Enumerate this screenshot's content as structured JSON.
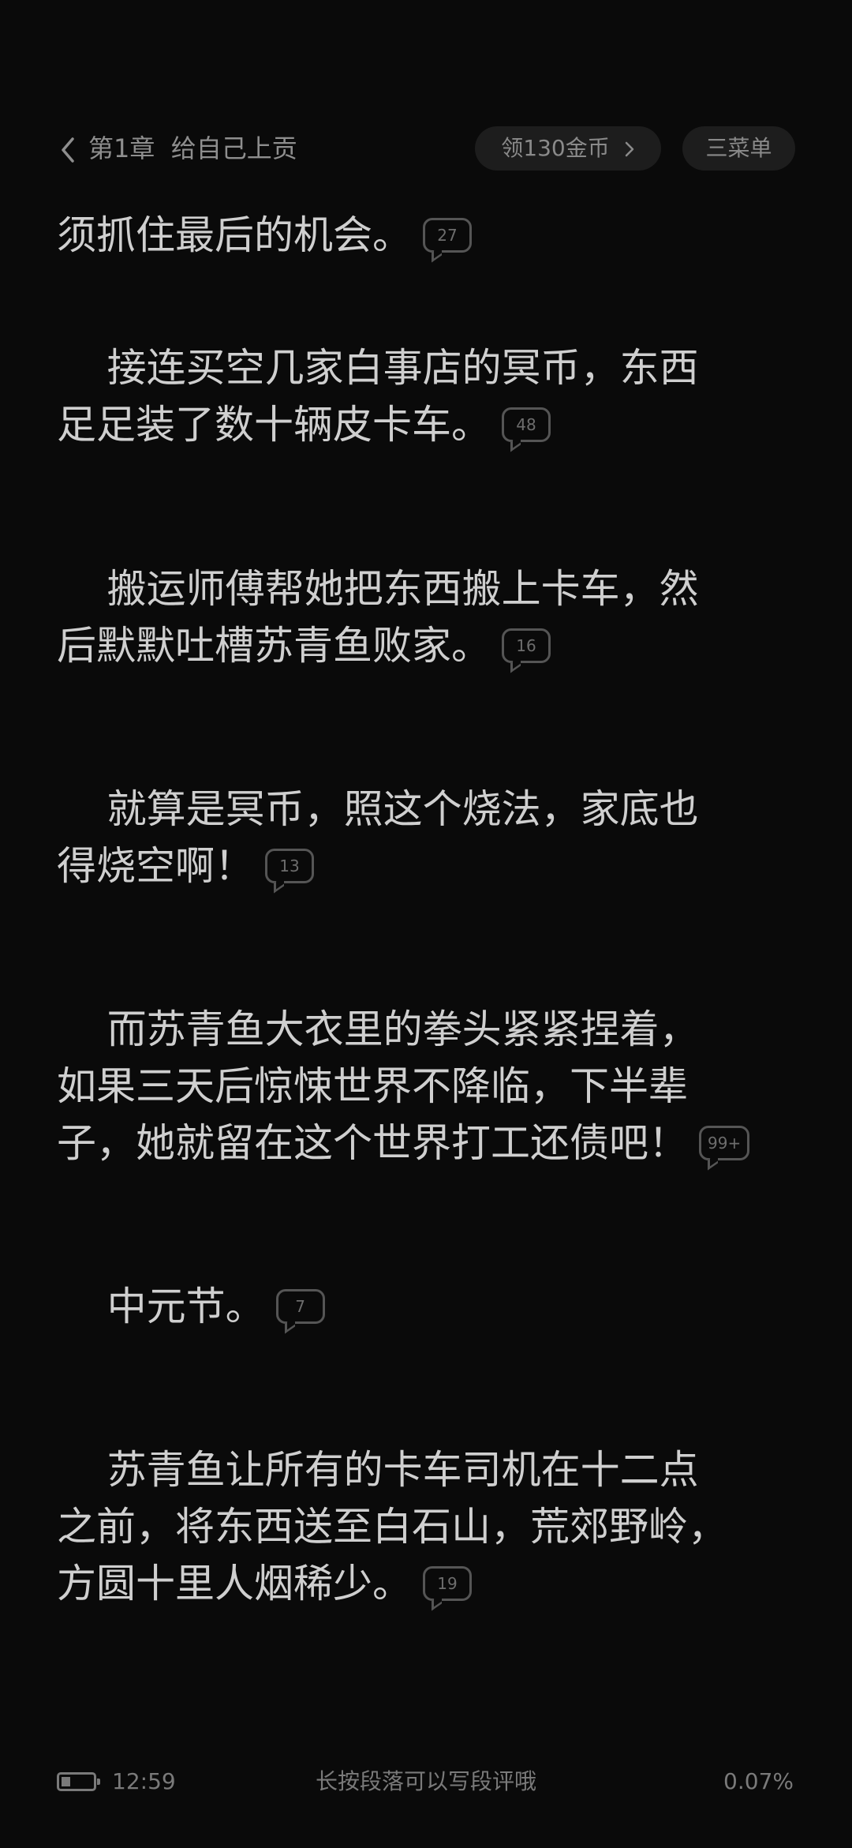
{
  "header": {
    "back_icon": "chevron-left-icon",
    "chapter_title": "第1章  给自己上贡",
    "coins_label": "领130金币",
    "coins_chevron_icon": "chevron-right-icon",
    "menu_label": "三菜单"
  },
  "paragraph_lines": [
    {
      "text": "须抓住最后的机会。",
      "comments": "27"
    },
    {
      "text": "    接连买空几家白事店的冥币，东西",
      "comments": null
    },
    {
      "text": "足足装了数十辆皮卡车。",
      "comments": "48"
    },
    {
      "text": "    搬运师傅帮她把东西搬上卡车，然",
      "comments": null
    },
    {
      "text": "后默默吐槽苏青鱼败家。",
      "comments": "16"
    },
    {
      "text": "    就算是冥币，照这个烧法，家底也",
      "comments": null
    },
    {
      "text": "得烧空啊！",
      "comments": "13"
    },
    {
      "text": "    而苏青鱼大衣里的拳头紧紧捏着，",
      "comments": null
    },
    {
      "text": "如果三天后惊悚世界不降临，下半辈",
      "comments": null
    },
    {
      "text": "子，她就留在这个世界打工还债吧！",
      "comments": "99+"
    },
    {
      "text": "    中元节。",
      "comments": "7"
    },
    {
      "text": "    苏青鱼让所有的卡车司机在十二点",
      "comments": null
    },
    {
      "text": "之前，将东西送至白石山，荒郊野岭，",
      "comments": null
    },
    {
      "text": "方圆十里人烟稀少。",
      "comments": "19"
    }
  ],
  "footer": {
    "battery_level": 0.3,
    "time": "12:59",
    "hint": "长按段落可以写段评哦",
    "progress": "0.07%"
  },
  "colors": {
    "background": "#0a0a0a",
    "text": "#cfcfcf",
    "muted": "#8a8a8a",
    "pill_bg": "#1d1d1d"
  }
}
